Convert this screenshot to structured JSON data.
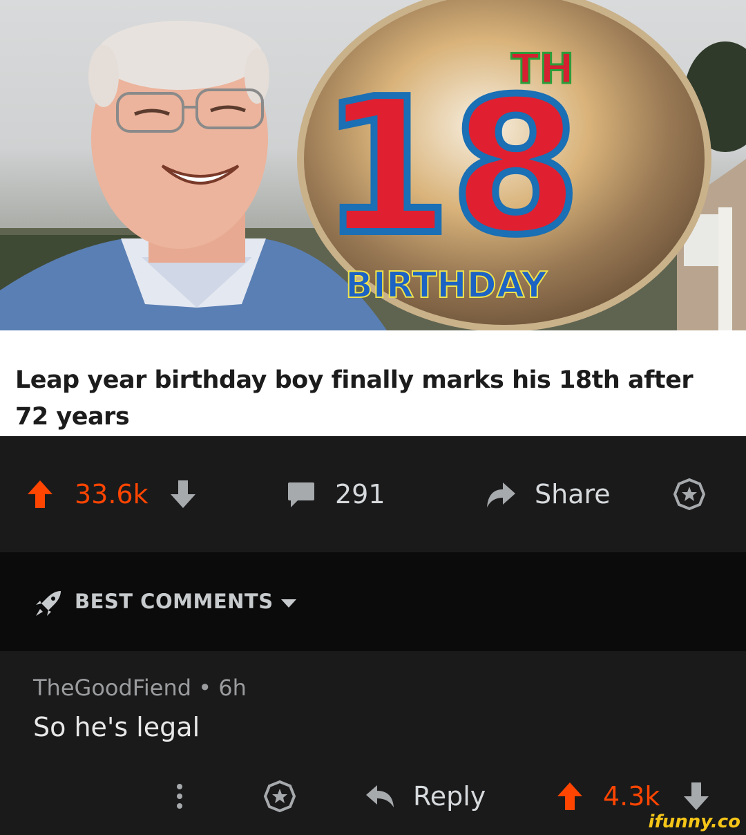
{
  "post": {
    "image_alt": "Smiling elderly man next to an 18th birthday balloon",
    "balloon_number": "18",
    "balloon_suffix": "TH",
    "balloon_word": "BIRTHDAY",
    "headline": "Leap year birthday boy finally marks his 18th after 72 years"
  },
  "actions": {
    "upvote_count": "33.6k",
    "comment_count": "291",
    "share_label": "Share"
  },
  "sort": {
    "label": "BEST COMMENTS"
  },
  "comment": {
    "author": "TheGoodFiend",
    "separator": "•",
    "age": "6h",
    "body": "So he's legal",
    "reply_label": "Reply",
    "score": "4.3k"
  },
  "watermark": "ifunny.co",
  "colors": {
    "upvote": "#ff4500",
    "background": "#1a1a1b",
    "sort_bar": "#0b0b0b",
    "text_primary": "#d7dadc"
  }
}
